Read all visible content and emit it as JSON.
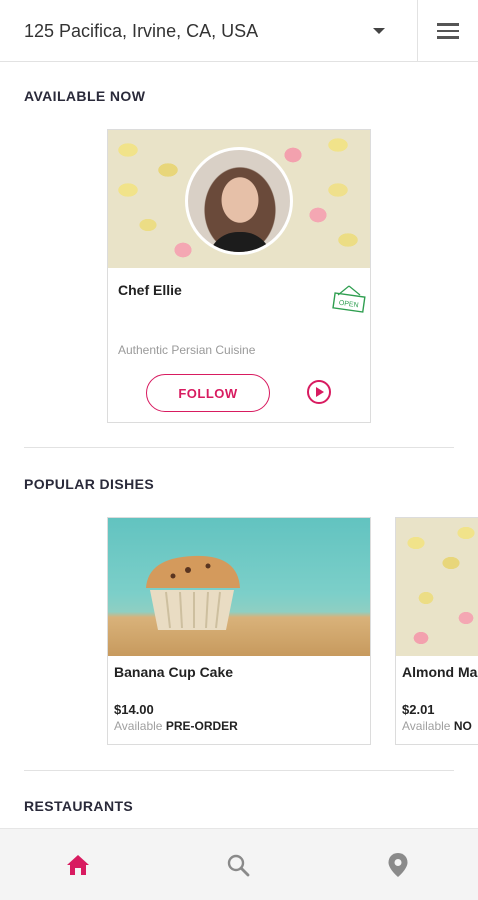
{
  "header": {
    "location": "125 Pacifica, Irvine, CA, USA",
    "dropdown_icon": "caret-down-icon",
    "menu_icon": "hamburger-menu-icon"
  },
  "available_now": {
    "title": "AVAILABLE NOW",
    "chef": {
      "name": "Chef Ellie",
      "cuisine": "Authentic Persian Cuisine",
      "status": "OPEN",
      "follow_label": "FOLLOW"
    }
  },
  "popular_dishes": {
    "title": "POPULAR DISHES",
    "items": [
      {
        "name": "Banana Cup Cake",
        "price": "$14.00",
        "available_label": "Available",
        "available_value": "PRE-ORDER"
      },
      {
        "name": "Almond Ma",
        "price": "$2.01",
        "available_label": "Available",
        "available_value": "NO"
      }
    ]
  },
  "restaurants": {
    "title": "RESTAURANTS"
  },
  "colors": {
    "accent": "#d81b60",
    "open_green": "#2e9e4f"
  },
  "bottom_nav": {
    "items": [
      "home-icon",
      "search-icon",
      "location-pin-icon"
    ]
  }
}
